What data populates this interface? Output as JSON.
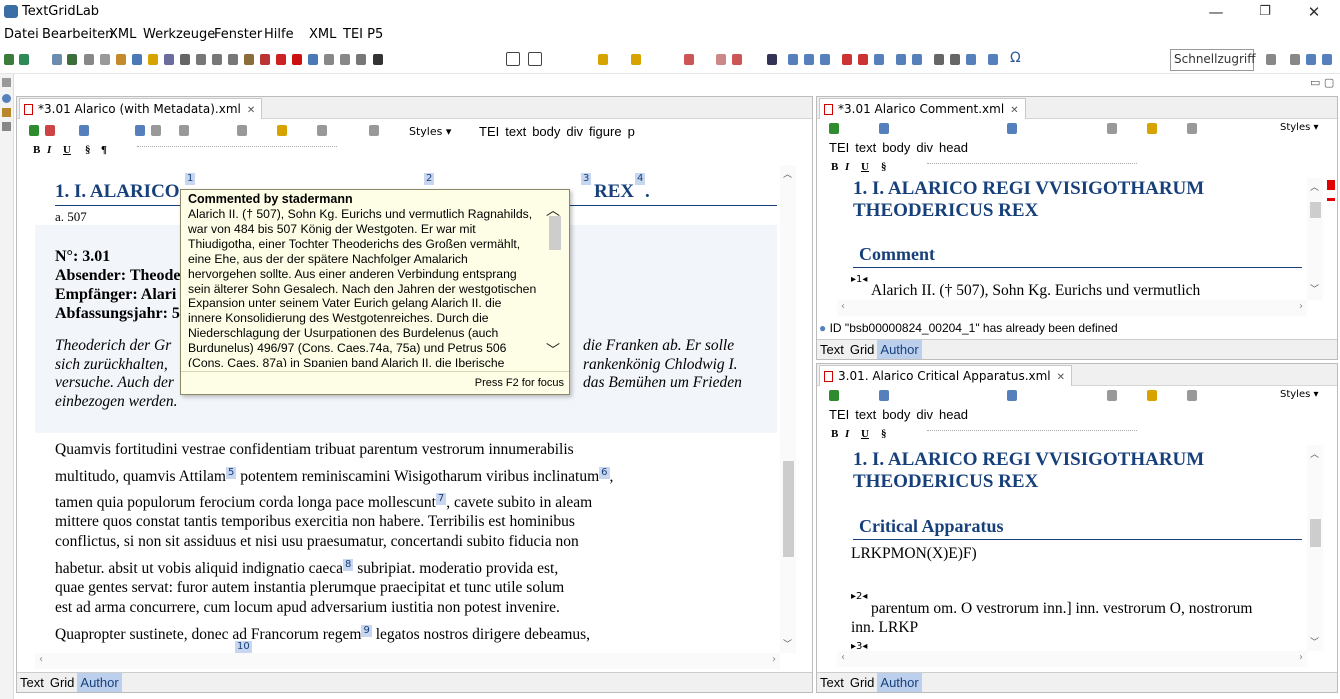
{
  "app": {
    "title": "TextGridLab"
  },
  "menu": [
    "Datei",
    "Bearbeiten",
    "XML",
    "Werkzeuge",
    "Fenster",
    "Hilfe",
    "XML",
    "TEI P5"
  ],
  "toolbar": {
    "quick_access": "Schnellzugriff"
  },
  "left_editor": {
    "tab": "*3.01 Alarico (with Metadata).xml",
    "tags": [
      "TEI",
      "text",
      "body",
      "div",
      "figure",
      "p"
    ],
    "styles_label": "Styles",
    "heading_pre": "1. I. ALARICO",
    "heading_post": "REX",
    "date": "a. 507",
    "fn": [
      "1",
      "2",
      "3",
      "4",
      "5",
      "6",
      "7",
      "8",
      "9",
      "10"
    ],
    "meta": {
      "nr": "N°: 3.01",
      "sender": "Absender: Theode",
      "recipient": "Empfänger: Alari",
      "year": "Abfassungsjahr: 5"
    },
    "abstract": [
      "Theoderich der Gr",
      "sich zurückhalten,",
      "versuche. Auch der",
      "einbezogen werden."
    ],
    "abstract_right": [
      "die Franken ab. Er solle",
      "rankenkönig Chlodwig I.",
      "das Bemühen um Frieden"
    ],
    "body": [
      "Quamvis fortitudini vestrae confidentiam tribuat parentum vestrorum innumerabilis",
      "multitudo, quamvis Attilam",
      "potentem reminiscamini Wisigotharum viribus inclinatum",
      "tamen quia populorum ferocium corda longa pace mollescunt",
      ", cavete subito in aleam",
      "mittere quos constat tantis temporibus exercitia non habere. Terribilis est hominibus",
      "conflictus, si non sit assiduus et nisi usu praesumatur, concertandi subito fiducia non",
      "habetur. absit ut vobis aliquid indignatio caeca",
      "subripiat. moderatio provida est,",
      "quae gentes servat: furor autem instantia plerumque praecipitat et tunc utile solum",
      "est ad arma concurrere, cum locum apud adversarium iustitia non potest invenire.",
      "Quapropter sustinete, donec ad Francorum regem",
      "legatos nostros dirigere debeamus,"
    ]
  },
  "tooltip": {
    "title": "Commented by stadermann",
    "lines": [
      "Alarich II. († 507), Sohn Kg. Eurichs und vermutlich Ragnahilds,",
      "war von 484 bis 507 König der Westgoten. Er war mit",
      "Thiudigotha, einer Tochter Theoderichs des Großen vermählt,",
      "eine Ehe, aus der der spätere Nachfolger Amalarich",
      "hervorgehen sollte. Aus einer anderen Verbindung entsprang",
      "sein älterer Sohn Gesalech. Nach den Jahren der westgotischen",
      "Expansion unter seinem Vater Eurich gelang Alarich II. die",
      "innere Konsolidierung des Westgotenreiches. Durch die",
      "Niederschlagung der Usurpationen des Burdelenus (auch",
      "Burdunelus) 496/97 (Cons. Caes.74a, 75a) und Petrus 506",
      "(Cons. Caes. 87a) in Spanien band Alarich II. die Iberische"
    ],
    "footer": "Press F2 for focus"
  },
  "comment_editor": {
    "tab": "*3.01 Alarico Comment.xml",
    "tags": [
      "TEI",
      "text",
      "body",
      "div",
      "head"
    ],
    "styles_label": "Styles",
    "heading": [
      "1. I. ALARICO REGI VVISIGOTHARUM",
      "THEODERICUS REX"
    ],
    "section": "Comment",
    "note_marker": "1",
    "note_text": "Alarich II. († 507), Sohn Kg. Eurichs und vermutlich",
    "status": "ID \"bsb00000824_00204_1\" has already been defined"
  },
  "apparatus_editor": {
    "tab": "3.01. Alarico Critical Apparatus.xml",
    "tags": [
      "TEI",
      "text",
      "body",
      "div",
      "head"
    ],
    "styles_label": "Styles",
    "heading": [
      "1. I. ALARICO REGI VVISIGOTHARUM",
      "THEODERICUS REX"
    ],
    "section": "Critical Apparatus",
    "sigla": "LRKPMON(X)E)F)",
    "note2_marker": "2",
    "note2_text": [
      "parentum om. O vestrorum inn.] inn. vestrorum O, nostrorum",
      "inn. LRKP"
    ],
    "note3_marker": "3"
  },
  "modes": [
    "Text",
    "Grid",
    "Author"
  ],
  "colors": {
    "accent": "#17407a",
    "fn_bg": "#c8d6f0",
    "tooltip_bg": "#fefee6"
  }
}
